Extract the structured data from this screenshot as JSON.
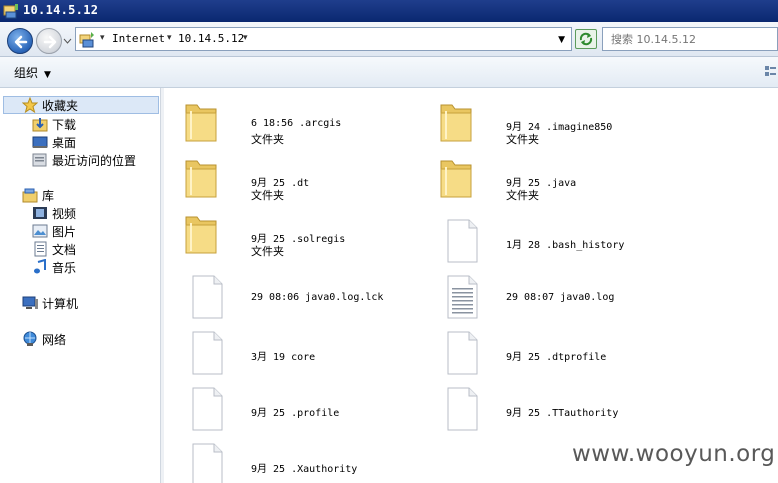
{
  "window": {
    "title": "10.14.5.12"
  },
  "address": {
    "crumbs": [
      "Internet",
      "10.14.5.12"
    ],
    "search_placeholder": "搜索 10.14.5.12"
  },
  "toolbar": {
    "organize_label": "组织"
  },
  "nav": {
    "favorites": {
      "label": "收藏夹",
      "items": [
        "下载",
        "桌面",
        "最近访问的位置"
      ]
    },
    "libraries": {
      "label": "库",
      "items": [
        "视频",
        "图片",
        "文档",
        "音乐"
      ]
    },
    "computer": {
      "label": "计算机"
    },
    "network": {
      "label": "网络"
    }
  },
  "files": [
    {
      "name": "6 18:56 .arcgis",
      "type": "文件夹",
      "kind": "folder"
    },
    {
      "name": "9月 24 .imagine850",
      "type": "文件夹",
      "kind": "folder"
    },
    {
      "name": "9月 25 .dt",
      "type": "文件夹",
      "kind": "folder"
    },
    {
      "name": "9月 25 .java",
      "type": "文件夹",
      "kind": "folder"
    },
    {
      "name": "9月 25 .solregis",
      "type": "文件夹",
      "kind": "folder"
    },
    {
      "name": "1月 28 .bash_history",
      "type": "",
      "kind": "file"
    },
    {
      "name": "29 08:06 java0.log.lck",
      "type": "",
      "kind": "file"
    },
    {
      "name": "29 08:07 java0.log",
      "type": "",
      "kind": "text"
    },
    {
      "name": "3月 19 core",
      "type": "",
      "kind": "file"
    },
    {
      "name": "9月 25 .dtprofile",
      "type": "",
      "kind": "file"
    },
    {
      "name": "9月 25 .profile",
      "type": "",
      "kind": "file"
    },
    {
      "name": "9月 25 .TTauthority",
      "type": "",
      "kind": "file"
    },
    {
      "name": "9月 25 .Xauthority",
      "type": "",
      "kind": "file"
    }
  ],
  "watermark": "www.wooyun.org"
}
